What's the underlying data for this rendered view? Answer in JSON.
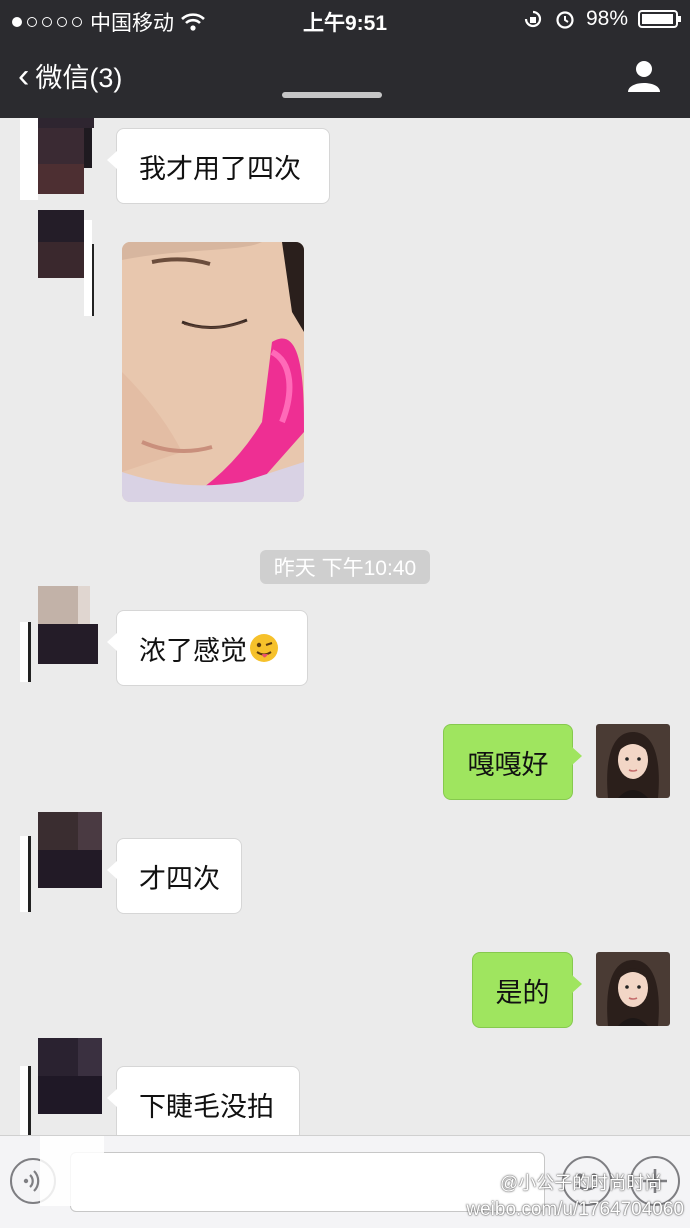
{
  "status_bar": {
    "carrier": "中国移动",
    "time": "上午9:51",
    "battery": "98%",
    "battery_level": 0.98,
    "signal_bars_filled": 1,
    "signal_bars_total": 5
  },
  "nav": {
    "back_label": "微信(3)"
  },
  "messages": [
    {
      "side": "in",
      "type": "text",
      "text": "我才用了四次"
    },
    {
      "side": "in",
      "type": "photo"
    },
    {
      "side": "in",
      "type": "text",
      "text": "浓了感觉",
      "emoji": "😜"
    },
    {
      "side": "out",
      "type": "text",
      "text": "嘎嘎好"
    },
    {
      "side": "in",
      "type": "text",
      "text": "才四次"
    },
    {
      "side": "out",
      "type": "text",
      "text": "是的"
    },
    {
      "side": "in",
      "type": "text",
      "text": "下睫毛没拍"
    }
  ],
  "timestamp": "昨天 下午10:40",
  "watermark": {
    "handle": "@小公子的时尚时尚",
    "url": "weibo.com/u/1764704060"
  },
  "colors": {
    "topbar": "#2b2b2f",
    "chat_bg": "#ebebeb",
    "outgoing_bubble": "#9fe55f",
    "incoming_bubble": "#ffffff"
  },
  "icons": {
    "back": "chevron-left-icon",
    "contact": "person-icon",
    "voice": "voice-icon",
    "emoji": "emoji-icon",
    "plus": "plus-icon",
    "weibo": "weibo-logo-icon"
  }
}
